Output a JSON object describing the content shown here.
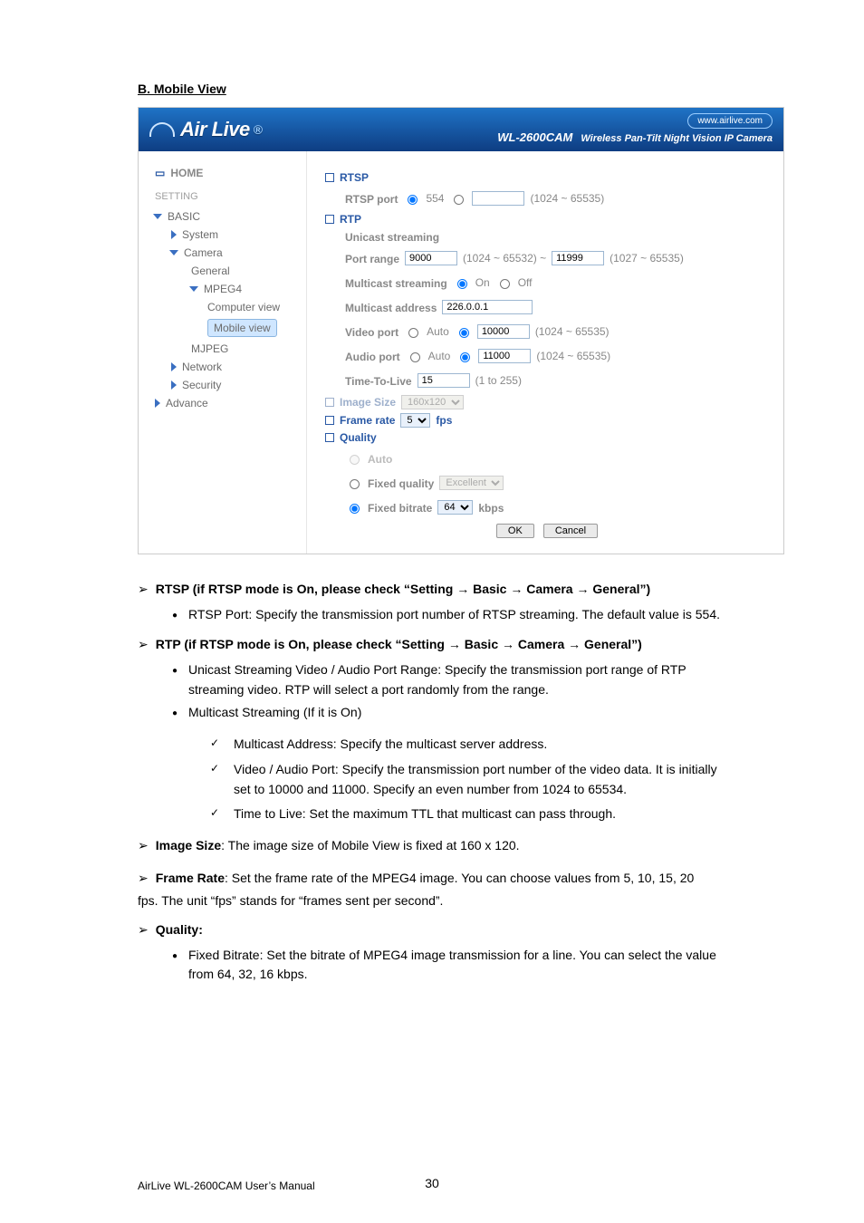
{
  "heading": "B. Mobile View",
  "header": {
    "logo": "Air Live",
    "url": "www.airlive.com",
    "model": "WL-2600CAM",
    "tagline": "Wireless Pan-Tilt Night Vision IP Camera"
  },
  "sidebar": {
    "home": "HOME",
    "setting": "SETTING",
    "basic": "BASIC",
    "system": "System",
    "camera": "Camera",
    "general": "General",
    "mpeg4": "MPEG4",
    "computer_view": "Computer view",
    "mobile_view": "Mobile view",
    "mjpeg": "MJPEG",
    "network": "Network",
    "security": "Security",
    "advance": "Advance"
  },
  "main": {
    "rtsp": {
      "title": "RTSP",
      "port_label": "RTSP port",
      "port_default": "554",
      "custom_port": "",
      "range": "(1024 ~ 65535)"
    },
    "rtp": {
      "title": "RTP",
      "unicast_title": "Unicast streaming",
      "port_range_label": "Port range",
      "port_range_from": "9000",
      "port_mid": "(1024 ~ 65532) ~",
      "port_range_to": "11999",
      "port_range_hint": "(1027 ~ 65535)",
      "mc_stream_label": "Multicast streaming",
      "on": "On",
      "off": "Off",
      "mc_addr_label": "Multicast address",
      "mc_addr": "226.0.0.1",
      "video_port_label": "Video port",
      "auto": "Auto",
      "video_port": "10000",
      "range1": "(1024 ~ 65535)",
      "audio_port_label": "Audio port",
      "audio_port": "11000",
      "range2": "(1024 ~ 65535)",
      "ttl_label": "Time-To-Live",
      "ttl": "15",
      "ttl_range": "(1 to 255)"
    },
    "image_size": {
      "label": "Image Size",
      "value": "160x120"
    },
    "frame_rate": {
      "label": "Frame rate",
      "value": "5",
      "unit": "fps"
    },
    "quality": {
      "label": "Quality",
      "auto": "Auto",
      "fixed_quality": "Fixed quality",
      "fixed_quality_value": "Excellent",
      "fixed_bitrate": "Fixed bitrate",
      "fixed_bitrate_value": "64",
      "kbps": "kbps"
    },
    "buttons": {
      "ok": "OK",
      "cancel": "Cancel"
    }
  },
  "body": {
    "rtsp_line": "RTSP (if RTSP mode is On, please check “Setting → Basic → Camera → General”)",
    "rtsp_b1": "RTSP Port: Specify the transmission port number of RTSP streaming. The default value is 554.",
    "rtp_line": "RTP (if RTSP mode is On, please check “Setting → Basic → Camera → General”)",
    "rtp_b1a": "Unicast Streaming Video / Audio Port Range: Specify the transmission port range of RTP",
    "rtp_b1b": "streaming video. RTP will select a port randomly from the range.",
    "rtp_b2": "Multicast Streaming (If it is On)",
    "rtp_c1": "Multicast Address: Specify the multicast server address.",
    "rtp_c2a": "Video / Audio Port: Specify the transmission port number of the video data. It is initially",
    "rtp_c2b": "set to 10000 and 11000. Specify an even number from 1024 to 65534.",
    "rtp_c3": "Time to Live: Set the maximum TTL that multicast can pass through.",
    "imgsize_label": "Image Size",
    "imgsize_text": ": The image size of Mobile View is fixed at 160 x 120.",
    "fr_label": "Frame Rate",
    "fr_text": ": Set the frame rate of the MPEG4 image. You can choose values from 5, 10, 15, 20",
    "fr_tail": "fps. The unit “fps” stands for “frames sent per second”.",
    "q_label": "Quality:",
    "q_b1a": "Fixed Bitrate: Set the bitrate of MPEG4 image transmission for a line. You can select the value",
    "q_b1b": "from 64, 32, 16 kbps."
  },
  "footer": {
    "manual": "AirLive WL-2600CAM User’s Manual",
    "page": "30"
  }
}
